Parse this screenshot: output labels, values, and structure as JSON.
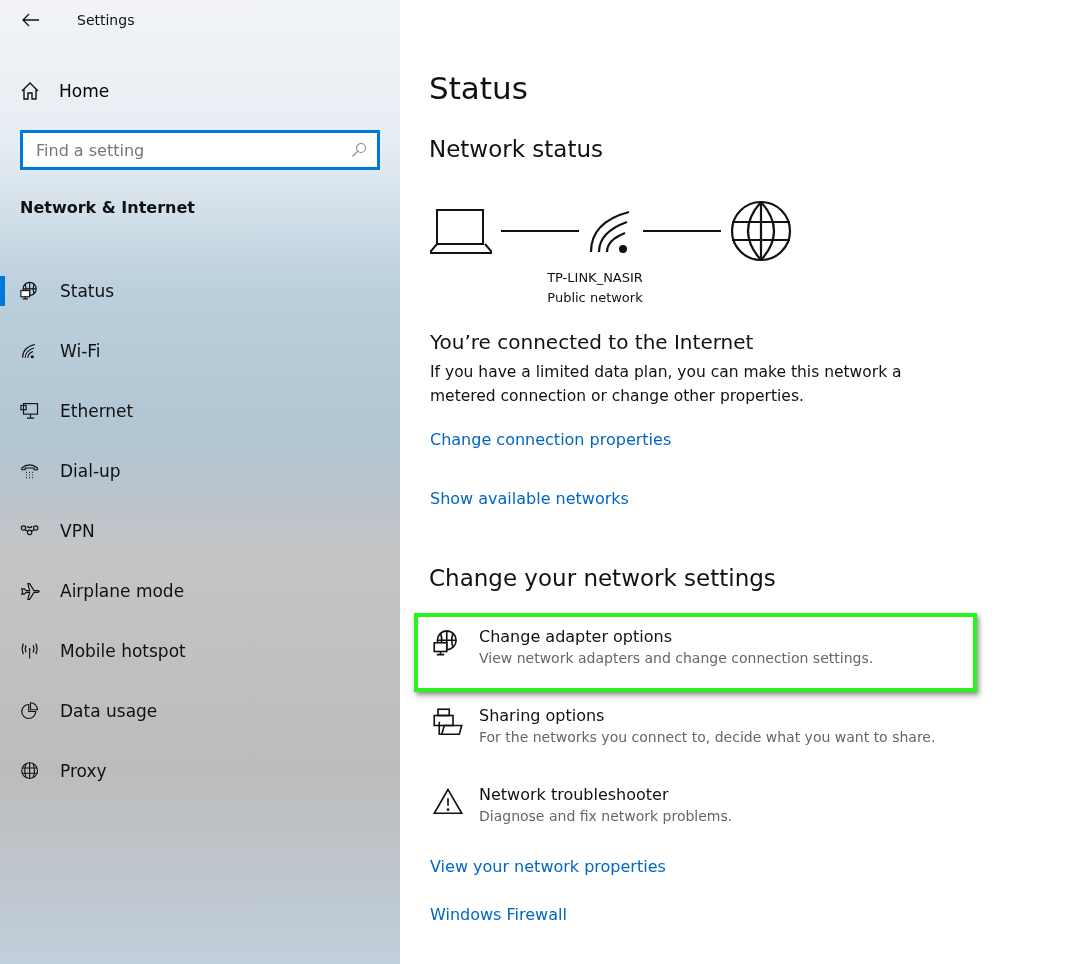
{
  "window": {
    "title": "Settings"
  },
  "sidebar": {
    "home": "Home",
    "search": {
      "placeholder": "Find a setting"
    },
    "section_title": "Network & Internet",
    "items": [
      {
        "kind": "status",
        "label": "Status",
        "selected": true
      },
      {
        "kind": "wifi",
        "label": "Wi-Fi",
        "selected": false
      },
      {
        "kind": "ethernet",
        "label": "Ethernet",
        "selected": false
      },
      {
        "kind": "dialup",
        "label": "Dial-up",
        "selected": false
      },
      {
        "kind": "vpn",
        "label": "VPN",
        "selected": false
      },
      {
        "kind": "airplane",
        "label": "Airplane mode",
        "selected": false
      },
      {
        "kind": "hotspot",
        "label": "Mobile hotspot",
        "selected": false
      },
      {
        "kind": "data",
        "label": "Data usage",
        "selected": false
      },
      {
        "kind": "proxy",
        "label": "Proxy",
        "selected": false
      }
    ]
  },
  "main": {
    "title": "Status",
    "network_status_heading": "Network status",
    "diagram": {
      "network_name": "TP-LINK_NASIR",
      "network_type": "Public network"
    },
    "connection": {
      "heading": "You’re connected to the Internet",
      "description": "If you have a limited data plan, you can make this network a metered connection or change other properties.",
      "links": [
        "Change connection properties",
        "Show available networks"
      ]
    },
    "change_heading": "Change your network settings",
    "options": [
      {
        "kind": "adapter",
        "title": "Change adapter options",
        "description": "View network adapters and change connection settings.",
        "highlighted": true
      },
      {
        "kind": "sharing",
        "title": "Sharing options",
        "description": "For the networks you connect to, decide what you want to share.",
        "highlighted": false
      },
      {
        "kind": "troubleshooter",
        "title": "Network troubleshooter",
        "description": "Diagnose and fix network problems.",
        "highlighted": false
      }
    ],
    "links": [
      "View your network properties",
      "Windows Firewall"
    ]
  }
}
